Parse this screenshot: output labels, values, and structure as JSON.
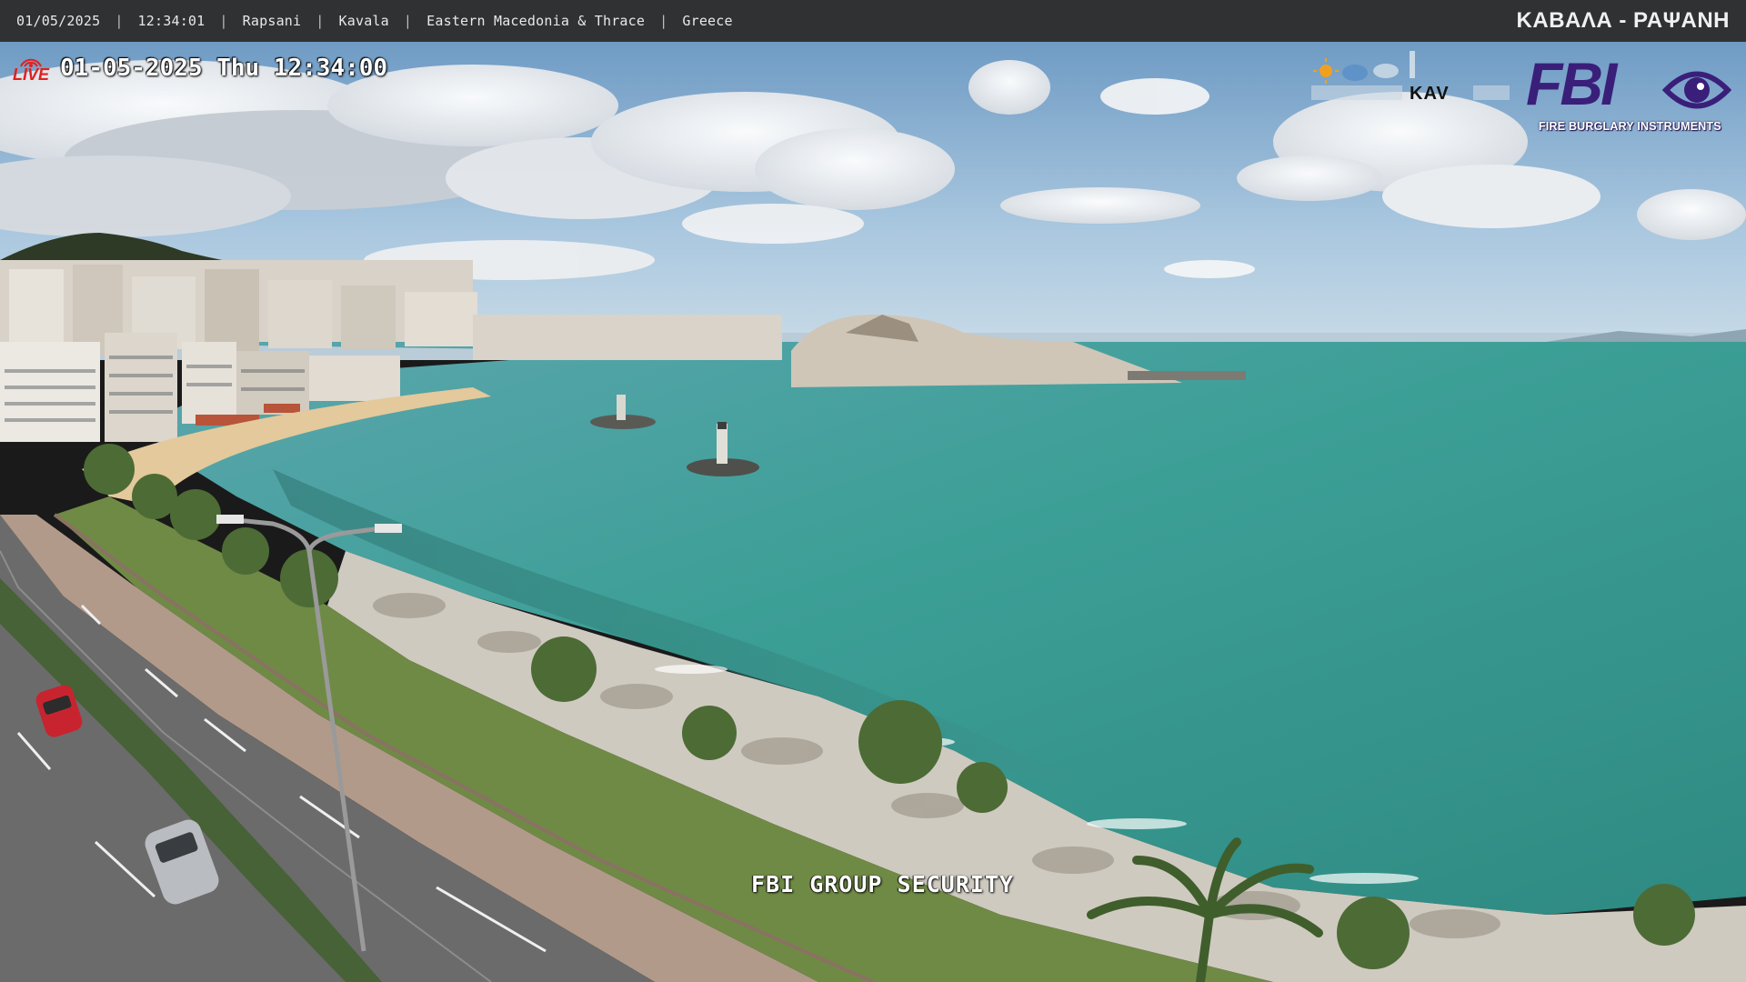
{
  "header": {
    "date": "01/05/2025",
    "time": "12:34:01",
    "location_parts": [
      "Rapsani",
      "Kavala",
      "Eastern Macedonia & Thrace",
      "Greece"
    ],
    "camera_title": "ΚΑΒΑΛΑ - ΡΑΨΑΝΗ"
  },
  "osd": {
    "live_label": "LIVE",
    "timestamp": "01-05-2025 Thu 12:34:00",
    "watermark": "FBI GROUP SECURITY"
  },
  "logos": {
    "meteo_text": "KAV",
    "fbi_word": "FBI",
    "fbi_tagline": "FIRE BURGLARY INSTRUMENTS"
  },
  "colors": {
    "topbar": "#2f3133",
    "live_red": "#e02020",
    "fbi_purple": "#3a1f7a",
    "sea": "#3a9e96",
    "sky": "#8fb7d6"
  }
}
